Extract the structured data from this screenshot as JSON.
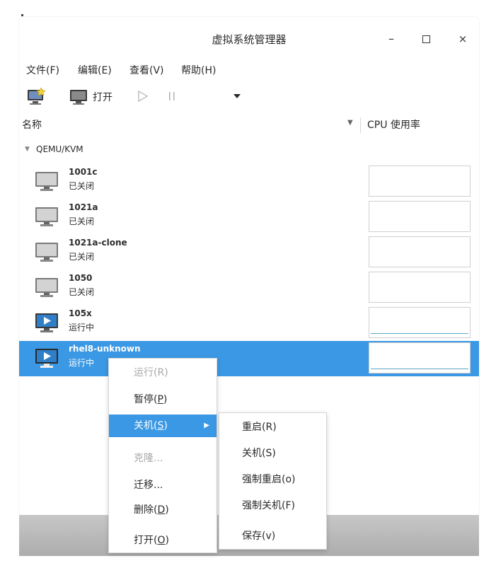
{
  "window": {
    "title": "虚拟系统管理器",
    "minimize_label": "–",
    "close_label": "×"
  },
  "menubar": {
    "items": [
      "文件(F)",
      "编辑(E)",
      "查看(V)",
      "帮助(H)"
    ]
  },
  "toolbar": {
    "new_vm_icon": "new-vm-icon",
    "open_label": "打开",
    "run_icon": "play-icon",
    "pause_icon": "pause-icon",
    "shutdown_dropdown_icon": "caret-down-icon"
  },
  "columns": {
    "name": "名称",
    "cpu": "CPU 使用率"
  },
  "group": {
    "label": "QEMU/KVM"
  },
  "vms": [
    {
      "name": "1001c",
      "status": "已关闭",
      "state": "off"
    },
    {
      "name": "1021a",
      "status": "已关闭",
      "state": "off"
    },
    {
      "name": "1021a-clone",
      "status": "已关闭",
      "state": "off"
    },
    {
      "name": "1050",
      "status": "已关闭",
      "state": "off"
    },
    {
      "name": "105x",
      "status": "运行中",
      "state": "running"
    },
    {
      "name": "rhel8-unknown",
      "status": "运行中",
      "state": "running",
      "selected": true
    }
  ],
  "context_menu": {
    "items": [
      {
        "label": "运行(R)",
        "disabled": true
      },
      {
        "label": "暂停(P)",
        "mnemonic": "P"
      },
      {
        "label": "关机(S)",
        "active": true,
        "submenu": true,
        "mnemonic": "S"
      },
      {
        "label": "克隆...",
        "disabled": true
      },
      {
        "label": "迁移..."
      },
      {
        "label": "删除(D)",
        "mnemonic": "D"
      },
      {
        "label": "打开(O)",
        "mnemonic": "O"
      }
    ]
  },
  "shutdown_submenu": {
    "items": [
      "重启(R)",
      "关机(S)",
      "强制重启(o)",
      "强制关机(F)",
      "保存(v)"
    ]
  },
  "colors": {
    "selection": "#3b98e4",
    "cpu_line": "#5fa8c8",
    "disabled_text": "#a8a8a8"
  }
}
